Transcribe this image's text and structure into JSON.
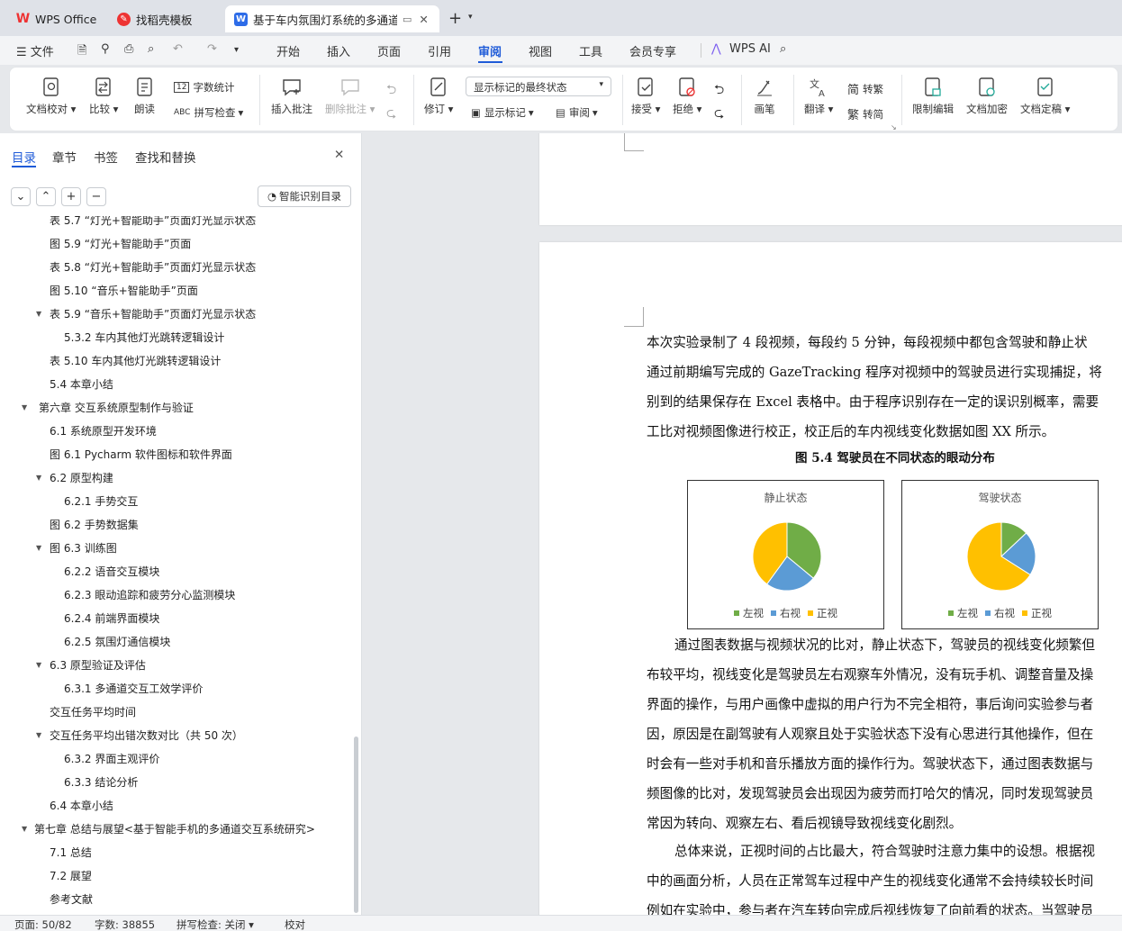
{
  "tabs": [
    {
      "label": "WPS Office",
      "icon": "wps-logo-icon",
      "color": "#e33"
    },
    {
      "label": "找稻壳模板",
      "icon": "docer-icon",
      "color": "#e33"
    },
    {
      "label": "基于车内氛围灯系统的多通道人",
      "icon": "word-doc-icon",
      "color": "#2d6ce8"
    }
  ],
  "menu": {
    "file": "文件",
    "items": [
      "开始",
      "插入",
      "页面",
      "引用",
      "审阅",
      "视图",
      "工具",
      "会员专享"
    ],
    "active": "审阅",
    "ai": "WPS AI"
  },
  "ribbon": {
    "doc_check": "文档校对",
    "compare": "比较",
    "read_aloud": "朗读",
    "word_count": "字数统计",
    "spell_check": "拼写检查",
    "insert_comment": "插入批注",
    "delete_comment": "删除批注",
    "revise": "修订",
    "markup_select": "显示标记的最终状态",
    "show_markup": "显示标记",
    "review": "审阅",
    "accept": "接受",
    "reject": "拒绝",
    "pen": "画笔",
    "translate": "翻译",
    "to_traditional": "转繁",
    "to_simplified": "转简",
    "restrict_edit": "限制编辑",
    "encrypt": "文档加密",
    "finalize": "文档定稿"
  },
  "sidebar": {
    "tabs": [
      "目录",
      "章节",
      "书签",
      "查找和替换"
    ],
    "smart_toc": "智能识别目录",
    "toc": [
      {
        "text": "表 5.7  “灯光+智能助手”页面灯光显示状态",
        "level": 2,
        "arrow": false
      },
      {
        "text": "图 5.9  “灯光+智能助手”页面",
        "level": 2,
        "arrow": false
      },
      {
        "text": "表 5.8  “灯光+智能助手”页面灯光显示状态",
        "level": 2,
        "arrow": false
      },
      {
        "text": "图 5.10  “音乐+智能助手”页面",
        "level": 2,
        "arrow": false
      },
      {
        "text": "表 5.9  “音乐+智能助手”页面灯光显示状态",
        "level": 2,
        "arrow": true
      },
      {
        "text": "5.3.2 车内其他灯光跳转逻辑设计",
        "level": 3,
        "arrow": false
      },
      {
        "text": "表 5.10  车内其他灯光跳转逻辑设计",
        "level": 2,
        "arrow": false
      },
      {
        "text": "5.4 本章小结",
        "level": 2,
        "arrow": false
      },
      {
        "text": "第六章  交互系统原型制作与验证",
        "level": 1,
        "arrow": true
      },
      {
        "text": "6.1 系统原型开发环境",
        "level": 2,
        "arrow": false
      },
      {
        "text": "图 6.1 Pycharm 软件图标和软件界面",
        "level": 2,
        "arrow": false
      },
      {
        "text": "6.2 原型构建",
        "level": 2,
        "arrow": true
      },
      {
        "text": "6.2.1 手势交互",
        "level": 3,
        "arrow": false
      },
      {
        "text": "图 6.2  手势数据集",
        "level": 2,
        "arrow": false
      },
      {
        "text": "图 6.3  训练图",
        "level": 2,
        "arrow": true
      },
      {
        "text": "6.2.2 语音交互模块",
        "level": 3,
        "arrow": false
      },
      {
        "text": "6.2.3 眼动追踪和疲劳分心监测模块",
        "level": 3,
        "arrow": false
      },
      {
        "text": "6.2.4 前端界面模块",
        "level": 3,
        "arrow": false
      },
      {
        "text": "6.2.5 氛围灯通信模块",
        "level": 3,
        "arrow": false
      },
      {
        "text": "6.3 原型验证及评估",
        "level": 2,
        "arrow": true
      },
      {
        "text": "6.3.1 多通道交互工效学评价",
        "level": 3,
        "arrow": false
      },
      {
        "text": "交互任务平均时间",
        "level": 2,
        "arrow": false
      },
      {
        "text": "交互任务平均出错次数对比（共 50 次）",
        "level": 2,
        "arrow": true
      },
      {
        "text": "6.3.2 界面主观评价",
        "level": 3,
        "arrow": false
      },
      {
        "text": "6.3.3 结论分析",
        "level": 3,
        "arrow": false
      },
      {
        "text": "6.4 本章小结",
        "level": 2,
        "arrow": false
      },
      {
        "text": "第七章  总结与展望<基于智能手机的多通道交互系统研究>",
        "level": 0,
        "arrow": true
      },
      {
        "text": "7.1 总结",
        "level": 2,
        "arrow": false
      },
      {
        "text": "7.2 展望",
        "level": 2,
        "arrow": false
      },
      {
        "text": "参考文献",
        "level": 2,
        "arrow": false
      }
    ]
  },
  "document": {
    "para1": [
      "本次实验录制了 4 段视频，每段约 5 分钟，每段视频中都包含驾驶和静止状",
      "通过前期编写完成的 GazeTracking 程序对视频中的驾驶员进行实现捕捉，将",
      "别到的结果保存在 Excel 表格中。由于程序识别存在一定的误识别概率，需要",
      "工比对视频图像进行校正，校正后的车内视线变化数据如图 XX 所示。"
    ],
    "figure_caption": "图 5.4  驾驶员在不同状态的眼动分布",
    "para2": [
      "通过图表数据与视频状况的比对，静止状态下，驾驶员的视线变化频繁但",
      "布较平均，视线变化是驾驶员左右观察车外情况，没有玩手机、调整音量及操",
      "界面的操作，与用户画像中虚拟的用户行为不完全相符，事后询问实验参与者",
      "因，原因是在副驾驶有人观察且处于实验状态下没有心思进行其他操作，但在",
      "时会有一些对手机和音乐播放方面的操作行为。驾驶状态下，通过图表数据与",
      "频图像的比对，发现驾驶员会出现因为疲劳而打哈欠的情况，同时发现驾驶员",
      "常因为转向、观察左右、看后视镜导致视线变化剧烈。"
    ],
    "para3": [
      "总体来说，正视时间的占比最大，符合驾驶时注意力集中的设想。根据视",
      "中的画面分析，人员在正常驾车过程中产生的视线变化通常不会持续较长时间",
      "例如在实验中，参与者在汽车转向完成后视线恢复了向前看的状态。当驾驶员"
    ]
  },
  "chart_data": [
    {
      "type": "pie",
      "title": "静止状态",
      "categories": [
        "左视",
        "右视",
        "正视"
      ],
      "values": [
        36,
        24,
        40
      ],
      "colors": [
        "#70ad47",
        "#5b9bd5",
        "#ffc000"
      ]
    },
    {
      "type": "pie",
      "title": "驾驶状态",
      "categories": [
        "左视",
        "右视",
        "正视"
      ],
      "values": [
        13,
        21,
        66
      ],
      "colors": [
        "#70ad47",
        "#5b9bd5",
        "#ffc000"
      ]
    }
  ],
  "status": {
    "page": "页面: 50/82",
    "words": "字数: 38855",
    "spell": "拼写检查: 关闭",
    "proof": "校对"
  }
}
